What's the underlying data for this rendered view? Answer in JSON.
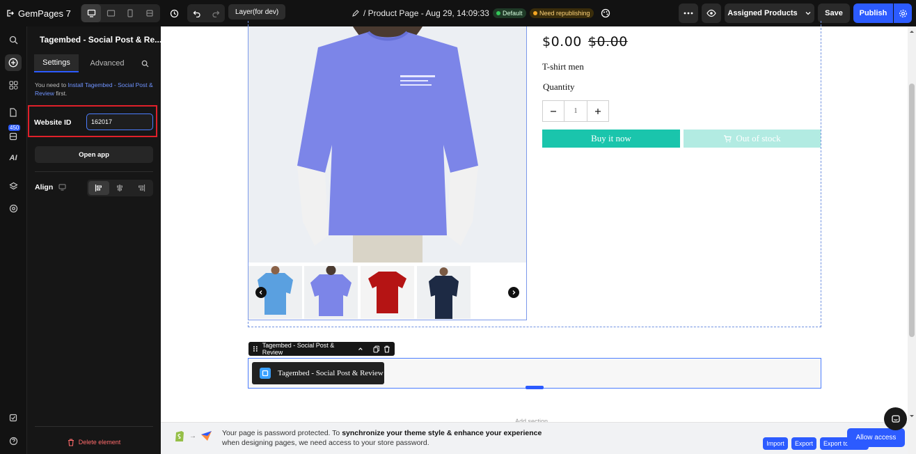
{
  "topbar": {
    "logo": "GemPages 7",
    "layer_tag": "Layer(for dev)",
    "page_title": "/ Product Page - Aug 29, 14:09:33",
    "badge_default": "Default",
    "badge_warning": "Need republishing",
    "assigned_products": "Assigned Products",
    "save": "Save",
    "publish": "Publish"
  },
  "rail": {
    "badge": "450"
  },
  "panel": {
    "title": "Tagembed - Social Post & Re...",
    "tab_settings": "Settings",
    "tab_advanced": "Advanced",
    "notice_prefix": "You need to ",
    "notice_link": "Install Tagembed - Social Post & Review",
    "notice_suffix": " first.",
    "website_id_label": "Website ID",
    "website_id_value": "162017",
    "open_app": "Open app",
    "align_label": "Align",
    "delete_element": "Delete element"
  },
  "product": {
    "price": "$0.00",
    "compare_price": "$0.00",
    "name": "T-shirt men",
    "quantity_label": "Quantity",
    "quantity_value": "1",
    "buy_now": "Buy it now",
    "out_of_stock": "Out of stock"
  },
  "element": {
    "toolbar_label": "Tagembed - Social Post & Review",
    "widget_label": "Tagembed - Social Post & Review",
    "faded_text": "Add section"
  },
  "banner": {
    "text_1": "Your page is password protected. To ",
    "text_bold": "synchronize your theme style & enhance your experience",
    "text_2": " when designing pages, we need access to your store password.",
    "import": "Import",
    "export": "Export",
    "export_local": "Export to Local",
    "allow_access": "Allow access"
  },
  "colors": {
    "accent": "#2c5bff",
    "buy_button": "#1ac5ac",
    "out_of_stock": "#b2ebe2",
    "highlight_border": "#e0202a"
  }
}
